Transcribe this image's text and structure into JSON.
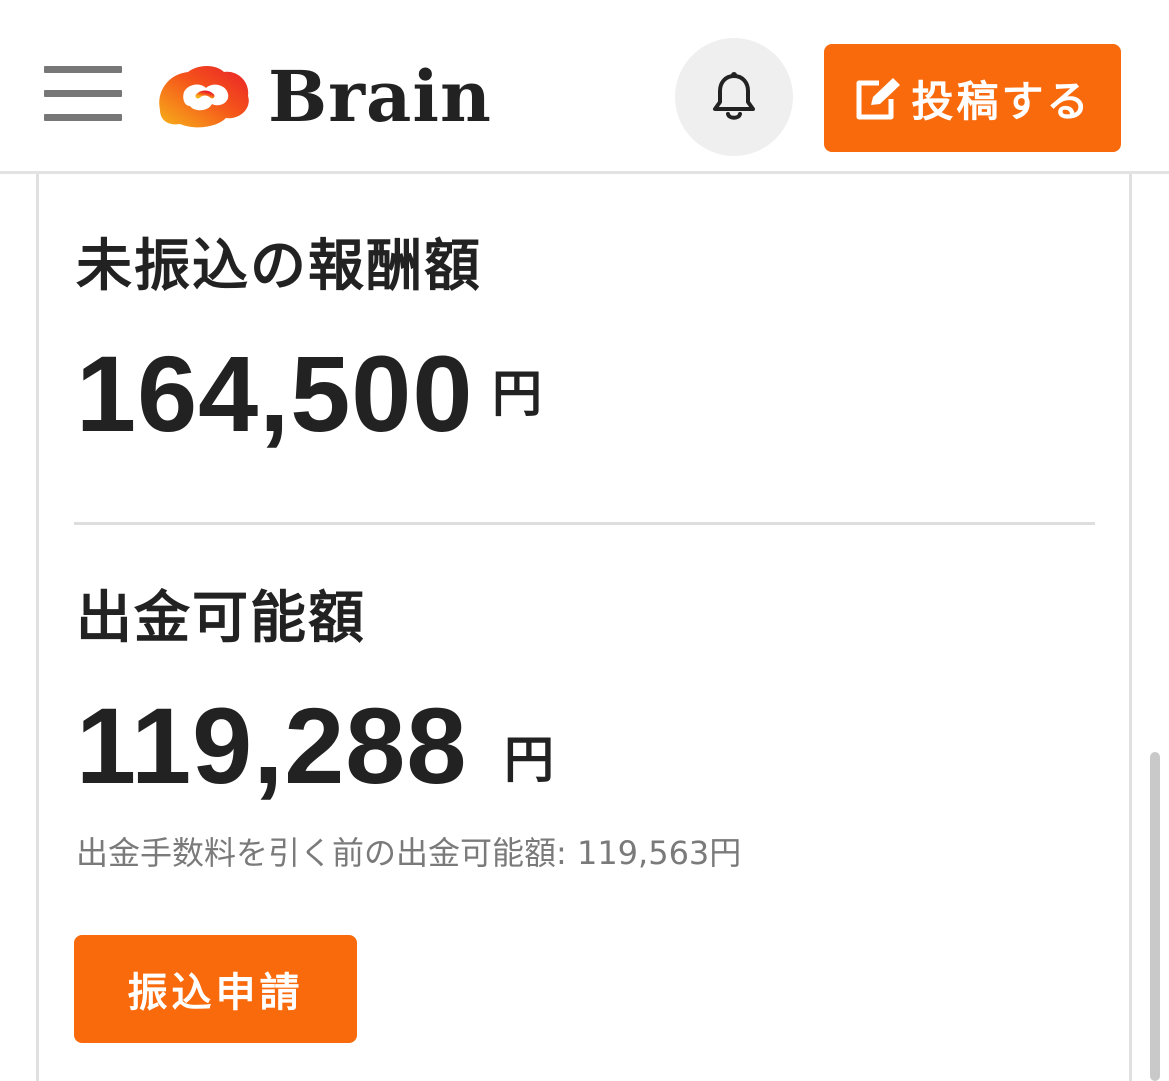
{
  "header": {
    "logo_text": "Brain",
    "post_button_label": "投稿する"
  },
  "unpaid": {
    "title": "未振込の報酬額",
    "amount": "164,500",
    "currency": "円"
  },
  "withdrawable": {
    "title": "出金可能額",
    "amount": "119,288",
    "currency": "円",
    "note": "出金手数料を引く前の出金可能額: 119,563円"
  },
  "transfer_button_label": "振込申請",
  "colors": {
    "accent": "#f86a0b",
    "text": "#222222",
    "muted": "#7a7a7a"
  },
  "icons": {
    "menu": "hamburger-menu-icon",
    "notification": "bell-icon",
    "post": "edit-icon"
  }
}
